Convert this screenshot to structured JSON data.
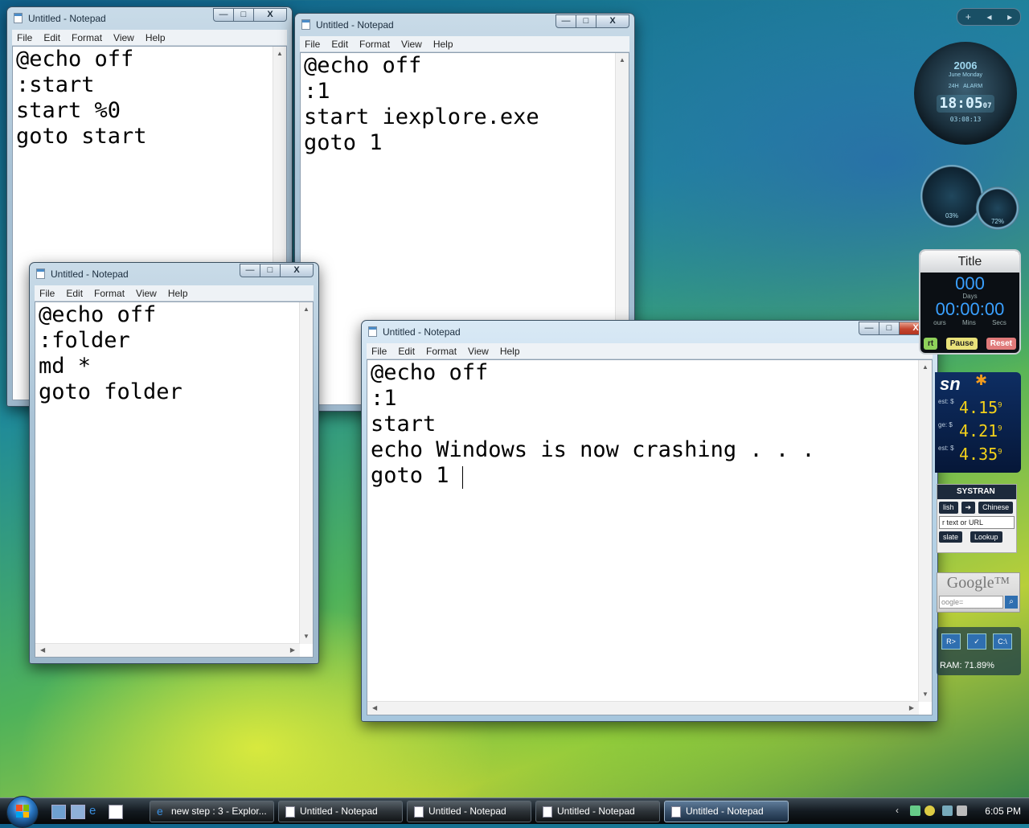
{
  "sidebar_top": {
    "add": "+",
    "prev": "◂",
    "next": "▸"
  },
  "menus": [
    "File",
    "Edit",
    "Format",
    "View",
    "Help"
  ],
  "windows": {
    "w1": {
      "title": "Untitled - Notepad",
      "text": "@echo off\n:start\nstart %0\ngoto start"
    },
    "w2": {
      "title": "Untitled - Notepad",
      "text": "@echo off\n:1\nstart iexplore.exe\ngoto 1"
    },
    "w3": {
      "title": "Untitled - Notepad",
      "text": "@echo off\n:folder\nmd *\ngoto folder"
    },
    "w4": {
      "title": "Untitled - Notepad",
      "text": "@echo off\n:1\nstart\necho Windows is now crashing . . .\ngoto 1"
    }
  },
  "window_controls": {
    "minimize": "—",
    "maximize": "□",
    "close": "X"
  },
  "scroll_arrows": {
    "up": "▲",
    "down": "▼",
    "left": "◀",
    "right": "▶"
  },
  "clock": {
    "year": "2006",
    "month": "June",
    "weekday": "Monday",
    "mode": "24H",
    "alarm": "ALARM",
    "time": "18:05",
    "seconds": "07",
    "secondary_time": "03:08:13"
  },
  "gauges": {
    "cpu": "03%",
    "ram": "72%"
  },
  "countdown": {
    "title": "Title",
    "days": "000",
    "days_label": "Days",
    "time": "00:00:00",
    "units": [
      "ours",
      "Mins",
      "Secs"
    ],
    "buttons": [
      "rt",
      "Pause",
      "Reset"
    ]
  },
  "msn": {
    "logo": "sn",
    "rows": [
      {
        "label": "est: $",
        "price": "4.15",
        "sup": "9"
      },
      {
        "label": "ge: $",
        "price": "4.21",
        "sup": "9"
      },
      {
        "label": "est: $",
        "price": "4.35",
        "sup": "9"
      }
    ]
  },
  "systran": {
    "brand": "SYSTRAN",
    "from": "lish",
    "to": "Chinese",
    "placeholder": "r text or URL",
    "translate": "slate",
    "lookup": "Lookup"
  },
  "google": {
    "logo": "Google™",
    "placeholder": "oogle="
  },
  "sysmon": {
    "icons": [
      "R>",
      "✓",
      "C:\\"
    ],
    "ram": "RAM: 71.89%"
  },
  "taskbar": {
    "items": [
      {
        "label": "new step : 3 - Explor...",
        "kind": "ie"
      },
      {
        "label": "Untitled - Notepad",
        "kind": "notepad"
      },
      {
        "label": "Untitled - Notepad",
        "kind": "notepad"
      },
      {
        "label": "Untitled - Notepad",
        "kind": "notepad"
      },
      {
        "label": "Untitled - Notepad",
        "kind": "notepad"
      }
    ],
    "clock": "6:05 PM"
  },
  "colors": {
    "accent": "#3aa0ff",
    "msn_price": "#f4d11a",
    "close_red": "#c4452f"
  }
}
